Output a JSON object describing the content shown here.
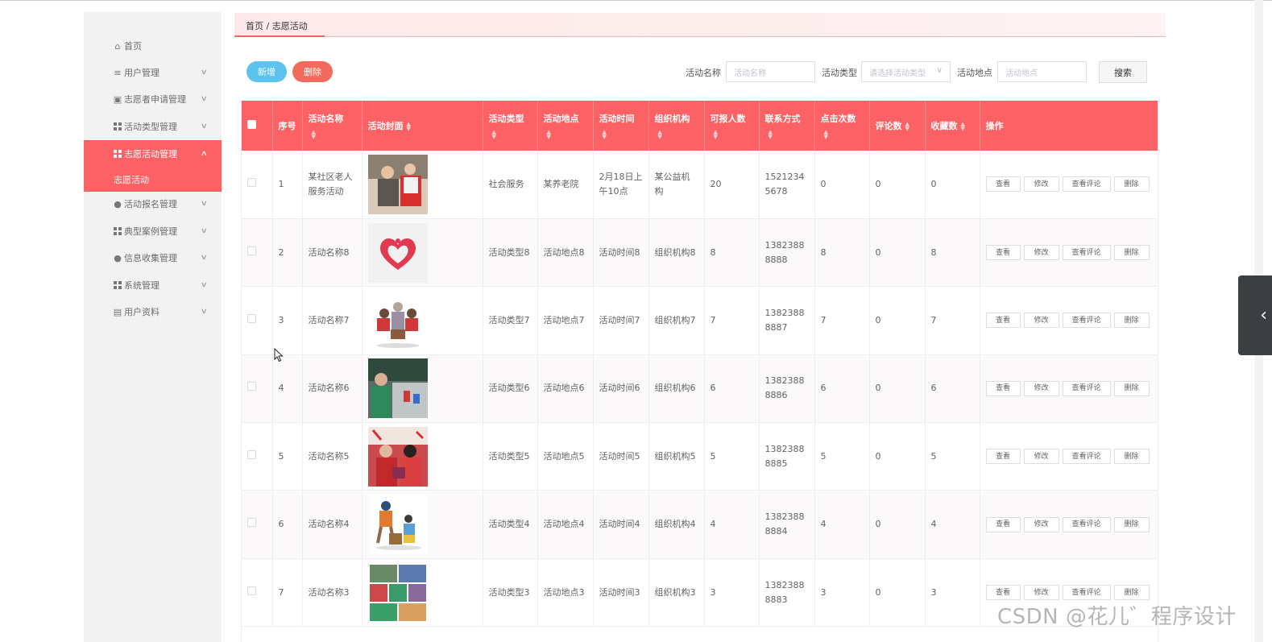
{
  "sidebar": {
    "items": [
      {
        "label": "首页",
        "icon": "home-icon",
        "has_arrow": false,
        "arrow": ""
      },
      {
        "label": "用户管理",
        "icon": "list-icon",
        "has_arrow": true,
        "arrow": "∨"
      },
      {
        "label": "志愿者申请管理",
        "icon": "clipboard-icon",
        "has_arrow": true,
        "arrow": "∨"
      },
      {
        "label": "活动类型管理",
        "icon": "grid-icon",
        "has_arrow": true,
        "arrow": "∨"
      },
      {
        "label": "志愿活动管理",
        "icon": "grid-icon",
        "has_arrow": true,
        "arrow": "∧",
        "active": true
      },
      {
        "label": "活动报名管理",
        "icon": "user-icon",
        "has_arrow": true,
        "arrow": "∨"
      },
      {
        "label": "典型案例管理",
        "icon": "grid-icon",
        "has_arrow": true,
        "arrow": "∨"
      },
      {
        "label": "信息收集管理",
        "icon": "location-icon",
        "has_arrow": true,
        "arrow": "∨"
      },
      {
        "label": "系统管理",
        "icon": "grid-icon",
        "has_arrow": true,
        "arrow": "∨"
      },
      {
        "label": "用户资料",
        "icon": "calendar-icon",
        "has_arrow": true,
        "arrow": "∨"
      }
    ],
    "submenu_active": "志愿活动"
  },
  "breadcrumb": "首页 / 志愿活动",
  "toolbar": {
    "add_label": "新增",
    "delete_label": "删除"
  },
  "filters": {
    "name_label": "活动名称",
    "name_placeholder": "活动名称",
    "type_label": "活动类型",
    "type_placeholder": "请选择活动类型",
    "place_label": "活动地点",
    "place_placeholder": "活动地点",
    "search_label": "搜索"
  },
  "table": {
    "headers": {
      "index": "序号",
      "name": "活动名称",
      "cover": "活动封面",
      "type": "活动类型",
      "place": "活动地点",
      "time": "活动时间",
      "org": "组织机构",
      "quota": "可报人数",
      "contact": "联系方式",
      "clicks": "点击次数",
      "comments": "评论数",
      "favorites": "收藏数",
      "actions": "操作"
    },
    "action_labels": {
      "view": "查看",
      "edit": "修改",
      "view_comments": "查看评论",
      "delete": "删除"
    },
    "rows": [
      {
        "index": "1",
        "name": "某社区老人服务活动",
        "type": "社会服务",
        "place": "某养老院",
        "time": "2月18日上午10点",
        "org": "某公益机构",
        "quota": "20",
        "contact": "15212345678",
        "clicks": "0",
        "comments": "0",
        "favorites": "0"
      },
      {
        "index": "2",
        "name": "活动名称8",
        "type": "活动类型8",
        "place": "活动地点8",
        "time": "活动时间8",
        "org": "组织机构8",
        "quota": "8",
        "contact": "13823888888",
        "clicks": "8",
        "comments": "0",
        "favorites": "8"
      },
      {
        "index": "3",
        "name": "活动名称7",
        "type": "活动类型7",
        "place": "活动地点7",
        "time": "活动时间7",
        "org": "组织机构7",
        "quota": "7",
        "contact": "13823888887",
        "clicks": "7",
        "comments": "0",
        "favorites": "7"
      },
      {
        "index": "4",
        "name": "活动名称6",
        "type": "活动类型6",
        "place": "活动地点6",
        "time": "活动时间6",
        "org": "组织机构6",
        "quota": "6",
        "contact": "13823888886",
        "clicks": "6",
        "comments": "0",
        "favorites": "6"
      },
      {
        "index": "5",
        "name": "活动名称5",
        "type": "活动类型5",
        "place": "活动地点5",
        "time": "活动时间5",
        "org": "组织机构5",
        "quota": "5",
        "contact": "13823888885",
        "clicks": "5",
        "comments": "0",
        "favorites": "5"
      },
      {
        "index": "6",
        "name": "活动名称4",
        "type": "活动类型4",
        "place": "活动地点4",
        "time": "活动时间4",
        "org": "组织机构4",
        "quota": "4",
        "contact": "13823888884",
        "clicks": "4",
        "comments": "0",
        "favorites": "4"
      },
      {
        "index": "7",
        "name": "活动名称3",
        "type": "活动类型3",
        "place": "活动地点3",
        "time": "活动时间3",
        "org": "组织机构3",
        "quota": "3",
        "contact": "13823888883",
        "clicks": "3",
        "comments": "0",
        "favorites": "3"
      }
    ]
  },
  "watermark": "CSDN @花儿゛程序设计",
  "colors": {
    "accent": "#fc6265",
    "add_button": "#5bc3ee",
    "delete_button": "#f26a5d"
  }
}
